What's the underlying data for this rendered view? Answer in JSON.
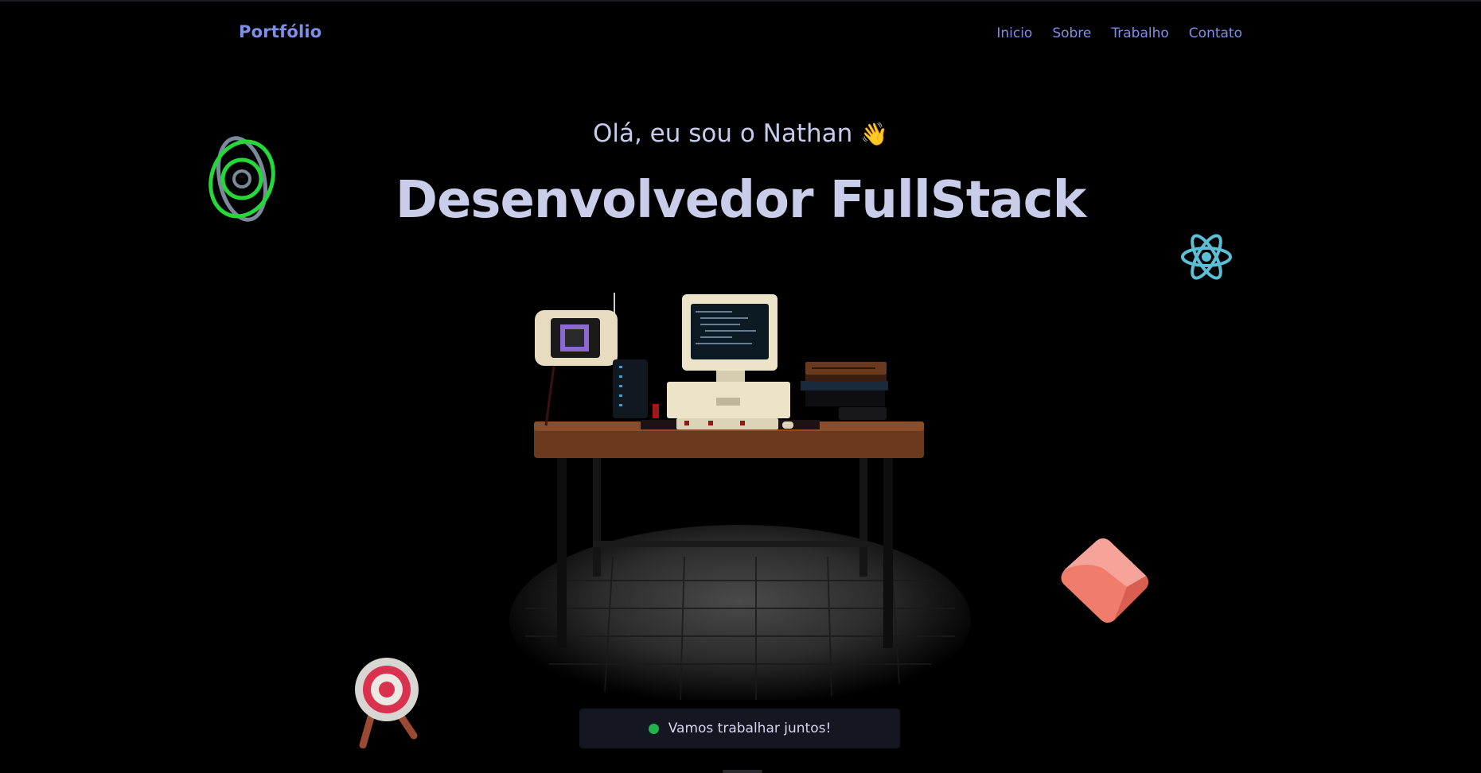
{
  "nav": {
    "brand": "Portfólio",
    "links": [
      "Inicio",
      "Sobre",
      "Trabalho",
      "Contato"
    ]
  },
  "hero": {
    "greeting": "Olá, eu sou o Nathan",
    "wave_emoji": "👋",
    "title": "Desenvolvedor FullStack"
  },
  "cta": {
    "label": "Vamos trabalhar juntos!",
    "status_color": "#22b24c"
  },
  "decorations": {
    "top_left": "rings-icon",
    "top_right": "react-atom-icon",
    "bottom_left": "target-icon",
    "bottom_right": "pink-cube-icon",
    "center": "retro-desk-scene"
  },
  "colors": {
    "background": "#000000",
    "accent": "#7f8ee8",
    "heading": "#c9cdea",
    "cta_background": "#141622"
  }
}
